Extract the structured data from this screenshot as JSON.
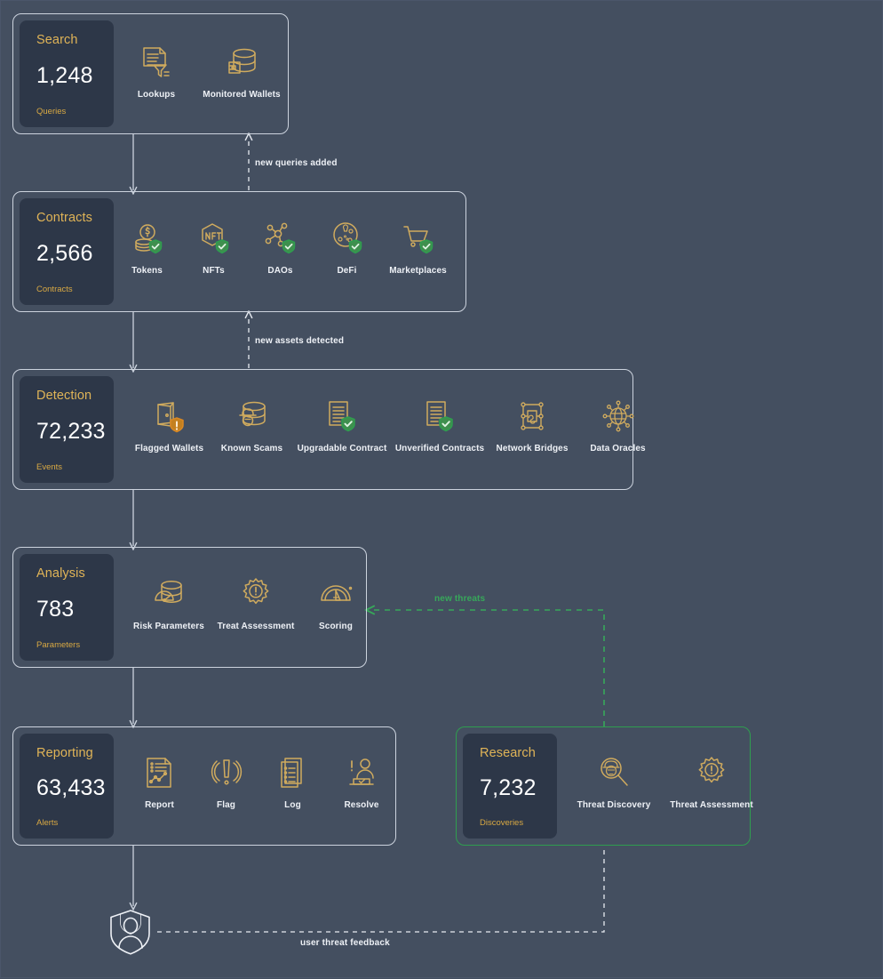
{
  "colors": {
    "background": "#444f60",
    "card": "#2d3748",
    "accent_gold": "#e0b457",
    "accent_amber": "#d9a943",
    "value_white": "#ffffff",
    "border_light": "#ccd3de",
    "accent_green": "#2f9e4f",
    "icon_gold": "#d0ab5e",
    "shield_green": "#2f9e4f",
    "shield_orange": "#d98824"
  },
  "stages": [
    {
      "id": "search",
      "title": "Search",
      "value": "1,248",
      "label": "Queries",
      "accent": "light",
      "items": [
        {
          "label": "Lookups",
          "icon": "document-filter-icon"
        },
        {
          "label": "Monitored Wallets",
          "icon": "database-wallet-icon"
        }
      ]
    },
    {
      "id": "contracts",
      "title": "Contracts",
      "value": "2,566",
      "label": "Contracts",
      "accent": "light",
      "items": [
        {
          "label": "Tokens",
          "icon": "coin-stack-shield-icon"
        },
        {
          "label": "NFTs",
          "icon": "nft-hexagon-shield-icon"
        },
        {
          "label": "DAOs",
          "icon": "network-nodes-shield-icon"
        },
        {
          "label": "DeFi",
          "icon": "defi-circle-shield-icon"
        },
        {
          "label": "Marketplaces",
          "icon": "shopping-cart-shield-icon"
        }
      ]
    },
    {
      "id": "detection",
      "title": "Detection",
      "value": "72,233",
      "label": "Events",
      "accent": "light",
      "items": [
        {
          "label": "Flagged Wallets",
          "icon": "wallet-alert-shield-icon"
        },
        {
          "label": "Known Scams",
          "icon": "database-thief-icon"
        },
        {
          "label": "Upgradable Contract",
          "icon": "document-check-shield-icon"
        },
        {
          "label": "Unverified Contracts",
          "icon": "document-check-shield-icon"
        },
        {
          "label": "Network Bridges",
          "icon": "network-bridge-icon"
        },
        {
          "label": "Data Oracles",
          "icon": "globe-oracle-icon"
        }
      ]
    },
    {
      "id": "analysis",
      "title": "Analysis",
      "value": "783",
      "label": "Parameters",
      "accent": "light",
      "items": [
        {
          "label": "Risk Parameters",
          "icon": "database-gauge-icon"
        },
        {
          "label": "Treat Assessment",
          "icon": "gear-alert-icon"
        },
        {
          "label": "Scoring",
          "icon": "speedometer-icon"
        }
      ]
    },
    {
      "id": "reporting",
      "title": "Reporting",
      "value": "63,433",
      "label": "Alerts",
      "accent": "light",
      "items": [
        {
          "label": "Report",
          "icon": "document-chart-icon"
        },
        {
          "label": "Flag",
          "icon": "alert-broadcast-icon"
        },
        {
          "label": "Log",
          "icon": "document-list-icon"
        },
        {
          "label": "Resolve",
          "icon": "person-desk-check-icon"
        }
      ]
    },
    {
      "id": "research",
      "title": "Research",
      "value": "7,232",
      "label": "Discoveries",
      "accent": "green",
      "items": [
        {
          "label": "Threat Discovery",
          "icon": "magnifier-thief-icon"
        },
        {
          "label": "Threat Assessment",
          "icon": "gear-alert-icon"
        }
      ]
    }
  ],
  "connectors": [
    {
      "id": "new-queries-added",
      "text": "new queries added",
      "color": "white"
    },
    {
      "id": "new-assets-detected",
      "text": "new assets detected",
      "color": "white"
    },
    {
      "id": "new-threats",
      "text": "new threats",
      "color": "green"
    },
    {
      "id": "user-threat-feedback",
      "text": "user threat feedback",
      "color": "white"
    }
  ],
  "user_node": {
    "icon": "user-shield-icon"
  }
}
